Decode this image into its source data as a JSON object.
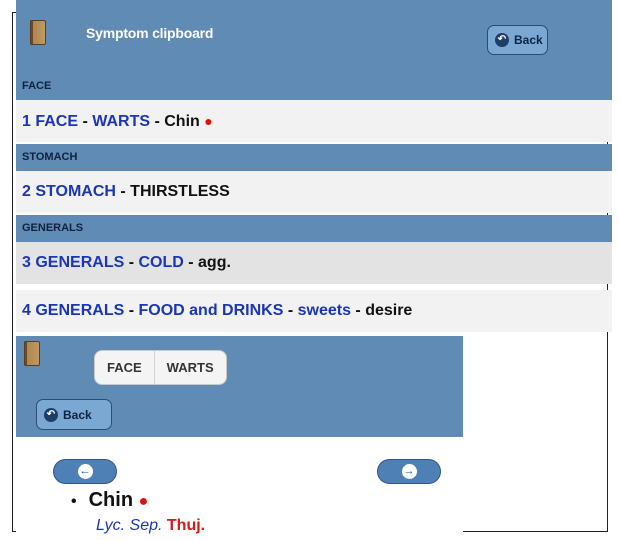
{
  "header": {
    "title": "Symptom clipboard",
    "back_label": "Back",
    "back_icon": "back-arrow-icon",
    "book_icon": "book-icon"
  },
  "sections": [
    {
      "heading": "FACE"
    },
    {
      "heading": "STOMACH"
    },
    {
      "heading": "GENERALS"
    }
  ],
  "symptoms": [
    {
      "num": "1",
      "parts": [
        "FACE",
        "WARTS"
      ],
      "detail": "Chin",
      "marked": true,
      "marker": "●"
    },
    {
      "num": "2",
      "parts": [
        "STOMACH"
      ],
      "detail": "THIRSTLESS"
    },
    {
      "num": "3",
      "parts": [
        "GENERALS",
        "COLD"
      ],
      "detail": "agg."
    },
    {
      "num": "4",
      "parts": [
        "GENERALS",
        "FOOD and DRINKS",
        "sweets"
      ],
      "detail": "desire"
    }
  ],
  "separator": " - ",
  "detail_panel": {
    "breadcrumb": [
      "FACE",
      "WARTS"
    ],
    "back_label": "Back",
    "prev_icon": "left-arrow-icon",
    "next_icon": "right-arrow-icon",
    "bullet_glyph": "•",
    "item": "Chin",
    "marker": "●",
    "remedies": [
      {
        "name": "Lyc.",
        "style": "italic-blue"
      },
      {
        "name": "Sep.",
        "style": "italic-blue"
      },
      {
        "name": "Thuj.",
        "style": "bold-red"
      }
    ]
  },
  "colors": {
    "header_blue": "#5f8bb5",
    "link_blue": "#1b35b5",
    "marker_red": "#e01010"
  }
}
